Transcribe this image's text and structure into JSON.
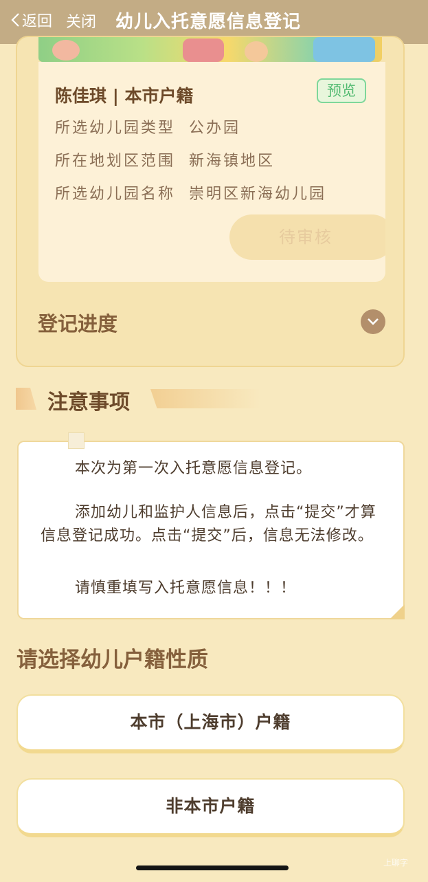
{
  "nav": {
    "back_label": "返回",
    "close_label": "关闭",
    "title": "幼儿入托意愿信息登记"
  },
  "card": {
    "child_name": "陈佳琪 | 本市户籍",
    "preview_label": "预览",
    "rows": [
      {
        "label": "所选幼儿园类型",
        "value": "公办园"
      },
      {
        "label": "所在地划区范围",
        "value": "新海镇地区"
      },
      {
        "label": "所选幼儿园名称",
        "value": "崇明区新海幼儿园"
      }
    ],
    "status": "待审核",
    "progress_label": "登记进度"
  },
  "notice": {
    "heading": "注意事项",
    "paragraphs": [
      "本次为第一次入托意愿信息登记。",
      "添加幼儿和监护人信息后，点击“提交”才算信息登记成功。点击“提交”后，信息无法修改。",
      "请慎重填写入托意愿信息！！！"
    ]
  },
  "select": {
    "title": "请选择幼儿户籍性质",
    "options": [
      "本市（上海市）户籍",
      "非本市户籍"
    ]
  },
  "watermark": "上聊字",
  "colors": {
    "page_bg": "#f8e9bf",
    "nav_bg": "#c3ac85",
    "accent_brown": "#85603c",
    "preview_green": "#4fb96f"
  }
}
